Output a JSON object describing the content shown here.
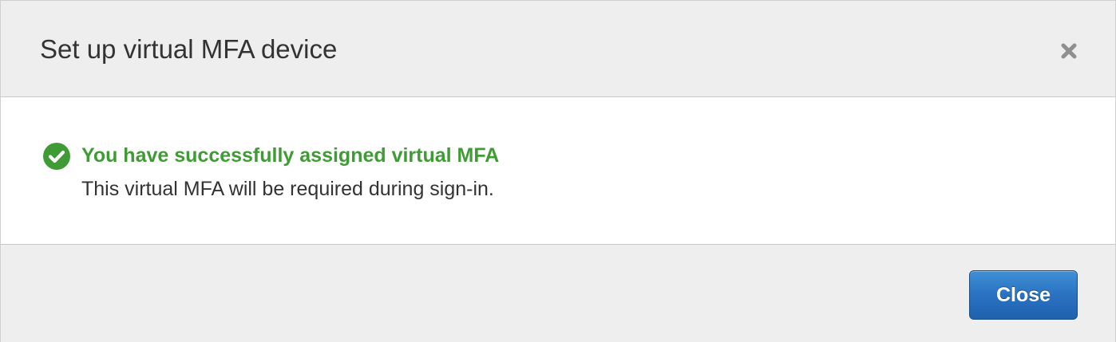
{
  "dialog": {
    "title": "Set up virtual MFA device",
    "close_icon": "close-icon"
  },
  "alert": {
    "type": "success",
    "icon": "check-circle-icon",
    "title": "You have successfully assigned virtual MFA",
    "message": "This virtual MFA will be required during sign-in."
  },
  "footer": {
    "close_label": "Close"
  },
  "colors": {
    "header_bg": "#eeeeee",
    "success_green": "#3f9c35",
    "primary_button": "#2a72c1",
    "text": "#333333"
  }
}
